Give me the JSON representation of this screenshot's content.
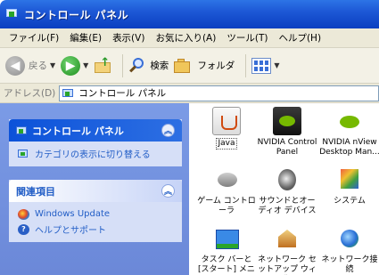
{
  "window": {
    "title": "コントロール パネル"
  },
  "menu": [
    "ファイル(F)",
    "編集(E)",
    "表示(V)",
    "お気に入り(A)",
    "ツール(T)",
    "ヘルプ(H)"
  ],
  "toolbar": {
    "back_label": "戻る",
    "search_label": "検索",
    "folders_label": "フォルダ"
  },
  "address": {
    "label": "アドレス(D)",
    "value": "コントロール パネル"
  },
  "sidebar": {
    "control_panel": {
      "title": "コントロール パネル",
      "link": "カテゴリの表示に切り替える"
    },
    "related": {
      "title": "関連項目",
      "links": [
        "Windows Update",
        "ヘルプとサポート"
      ]
    }
  },
  "items": [
    {
      "icon": "java-icon",
      "label": "Java"
    },
    {
      "icon": "nvidia-control-panel-icon",
      "label": "NVIDIA Control Panel"
    },
    {
      "icon": "nvidia-desktop-manager-icon",
      "label": "NVIDIA nView Desktop Man..."
    },
    {
      "icon": "game-controller-icon",
      "label": "ゲーム コントロ ーラ"
    },
    {
      "icon": "sound-icon",
      "label": "サウンドとオーディオ デバイス"
    },
    {
      "icon": "system-icon",
      "label": "システム"
    },
    {
      "icon": "taskbar-icon",
      "label": "タスク バーと [スタート] メニュー"
    },
    {
      "icon": "network-setup-icon",
      "label": "ネットワーク セットアップ ウィザ..."
    },
    {
      "icon": "network-connections-icon",
      "label": "ネットワーク接続"
    }
  ]
}
